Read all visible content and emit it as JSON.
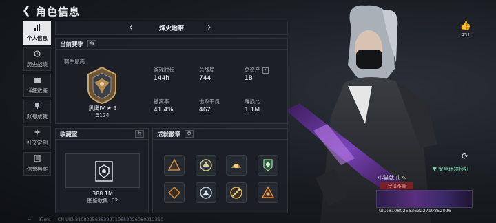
{
  "header": {
    "title": "角色信息"
  },
  "nav": [
    {
      "label": "个人信息",
      "icon": "bar-chart-icon",
      "active": true
    },
    {
      "label": "历史战绩",
      "icon": "history-icon",
      "active": false
    },
    {
      "label": "详细数据",
      "icon": "folder-icon",
      "active": false
    },
    {
      "label": "账号成就",
      "icon": "trophy-icon",
      "active": false
    },
    {
      "label": "社交定制",
      "icon": "custom-icon",
      "active": false
    },
    {
      "label": "信誉档案",
      "icon": "archive-icon",
      "active": false
    }
  ],
  "map": {
    "name": "烽火地带"
  },
  "season": {
    "title": "当前赛季",
    "subtitle": "赛季最高",
    "rank_name": "黑鹰IV ★ 3",
    "rank_score": "5124",
    "stats": [
      {
        "label": "游戏时长",
        "value": "144h"
      },
      {
        "label": "总战局",
        "value": "744"
      },
      {
        "label": "总资产",
        "value": "1B",
        "help": "?"
      },
      {
        "label": "撤离率",
        "value": "41.4%"
      },
      {
        "label": "击败干员",
        "value": "462"
      },
      {
        "label": "赚损比",
        "value": "1.1M"
      }
    ]
  },
  "vault": {
    "title": "收藏室",
    "value": "388.1M",
    "count": "图鉴收集: 62"
  },
  "achievements": {
    "title": "成就徽章"
  },
  "profile": {
    "likes": "451",
    "env_status": "安全环境良好",
    "player_name": "小猫就爪",
    "tag": "守信不渝",
    "banner_id": "UID:8108025636322719852026"
  },
  "footer": {
    "signal": "37ms",
    "uid": "CN UID:8108025636322719852026080012310"
  }
}
